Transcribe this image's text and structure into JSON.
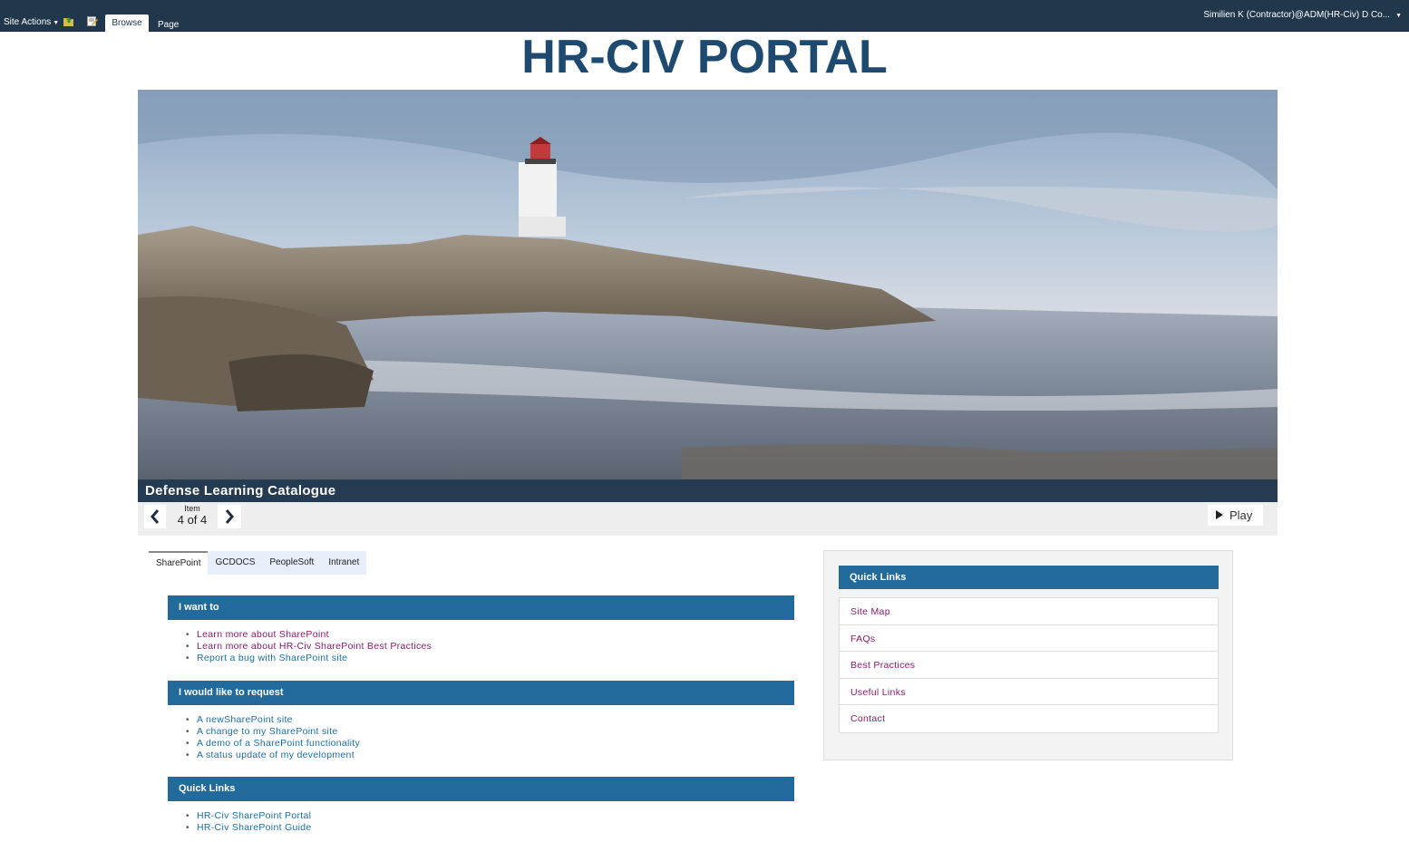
{
  "ribbon": {
    "site_actions": "Site Actions",
    "tabs": {
      "browse": "Browse",
      "page": "Page"
    },
    "user": "Similien K (Contractor)@ADM(HR-Civ) D Co..."
  },
  "title": "HR-CIV PORTAL",
  "carousel": {
    "caption": "Defense Learning Catalogue",
    "item_label": "Item",
    "position": "4 of 4",
    "play": "Play"
  },
  "tabs": [
    "SharePoint",
    "GCDOCS",
    "PeopleSoft",
    "Intranet"
  ],
  "sections": {
    "want": {
      "heading": "I want to",
      "links": [
        "Learn more about SharePoint",
        "Learn more about HR-Civ SharePoint Best Practices",
        "Report a bug with SharePoint site"
      ]
    },
    "request": {
      "heading": "I would like to request",
      "links": [
        "A newSharePoint site",
        "A change to my SharePoint site",
        "A demo of a SharePoint functionality",
        "A status update of my development"
      ]
    },
    "quick": {
      "heading": "Quick Links",
      "links": [
        "HR-Civ SharePoint Portal",
        "HR-Civ SharePoint Guide"
      ]
    }
  },
  "right_panel": {
    "heading": "Quick Links",
    "links": [
      "Site Map",
      "FAQs",
      "Best Practices",
      "Useful Links",
      "Contact"
    ]
  },
  "colors": {
    "ribbon": "#21374c",
    "title": "#1d4a6e",
    "section_header": "#216a9b",
    "link": "#1a6fa8",
    "visited_link": "#8a1a6c"
  }
}
